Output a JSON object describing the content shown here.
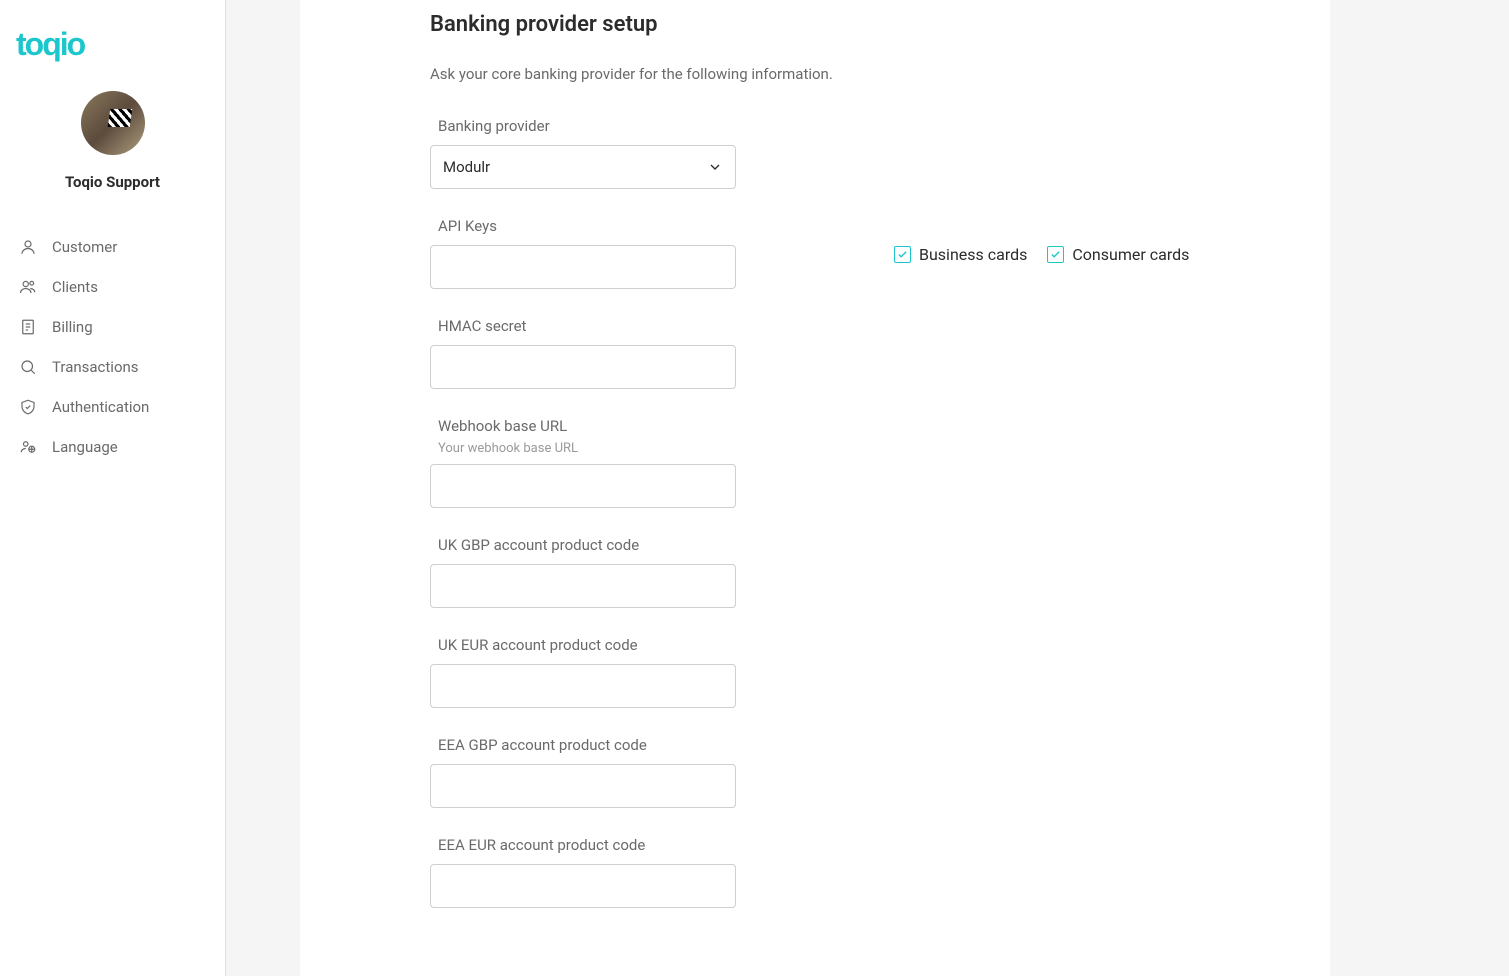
{
  "brand": "toqio",
  "profile": {
    "name": "Toqio Support"
  },
  "sidebar": {
    "items": [
      {
        "label": "Customer"
      },
      {
        "label": "Clients"
      },
      {
        "label": "Billing"
      },
      {
        "label": "Transactions"
      },
      {
        "label": "Authentication"
      },
      {
        "label": "Language"
      }
    ]
  },
  "page": {
    "title": "Banking provider setup",
    "description": "Ask your core banking provider for the following information."
  },
  "form": {
    "provider_label": "Banking provider",
    "provider_value": "Modulr",
    "api_keys_label": "API Keys",
    "api_keys_value": "",
    "hmac_label": "HMAC secret",
    "hmac_value": "",
    "webhook_label": "Webhook base URL",
    "webhook_sublabel": "Your webhook base URL",
    "webhook_value": "",
    "uk_gbp_label": "UK GBP account product code",
    "uk_gbp_value": "",
    "uk_eur_label": "UK EUR account product code",
    "uk_eur_value": "",
    "eea_gbp_label": "EEA GBP account product code",
    "eea_gbp_value": "",
    "eea_eur_label": "EEA EUR account product code",
    "eea_eur_value": ""
  },
  "checkboxes": {
    "business_label": "Business cards",
    "business_checked": true,
    "consumer_label": "Consumer cards",
    "consumer_checked": true
  }
}
